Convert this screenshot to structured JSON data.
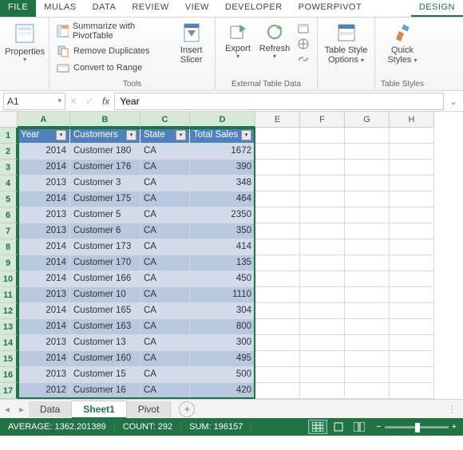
{
  "tabs": {
    "file": "FILE",
    "items": [
      "MULAS",
      "DATA",
      "REVIEW",
      "VIEW",
      "DEVELOPER",
      "POWERPIVOT"
    ],
    "active": "DESIGN"
  },
  "ribbon": {
    "properties": "Properties",
    "tools": {
      "pivot": "Summarize with PivotTable",
      "dedup": "Remove Duplicates",
      "range": "Convert to Range",
      "label": "Tools"
    },
    "slicer": {
      "top": "Insert",
      "bot": "Slicer"
    },
    "export": "Export",
    "refresh": "Refresh",
    "extlabel": "External Table Data",
    "styleopt": {
      "top": "Table Style",
      "bot": "Options"
    },
    "quick": {
      "top": "Quick",
      "bot": "Styles"
    },
    "styleslabel": "Table Styles"
  },
  "namebox": "A1",
  "formula": "Year",
  "colwidths": {
    "A": 66,
    "B": 88,
    "C": 62,
    "D": 82,
    "E": 56,
    "F": 56,
    "G": 56,
    "H": 56
  },
  "columns": [
    "A",
    "B",
    "C",
    "D",
    "E",
    "F",
    "G",
    "H"
  ],
  "headers": [
    "Year",
    "Customers",
    "State",
    "Total Sales"
  ],
  "rows": [
    {
      "n": 1,
      "y": "",
      "c": "",
      "s": "",
      "t": ""
    },
    {
      "n": 2,
      "y": "2014",
      "c": "Customer 180",
      "s": "CA",
      "t": "1672"
    },
    {
      "n": 3,
      "y": "2014",
      "c": "Customer 176",
      "s": "CA",
      "t": "390"
    },
    {
      "n": 4,
      "y": "2013",
      "c": "Customer 3",
      "s": "CA",
      "t": "348"
    },
    {
      "n": 5,
      "y": "2014",
      "c": "Customer 175",
      "s": "CA",
      "t": "464"
    },
    {
      "n": 6,
      "y": "2013",
      "c": "Customer 5",
      "s": "CA",
      "t": "2350"
    },
    {
      "n": 7,
      "y": "2013",
      "c": "Customer 6",
      "s": "CA",
      "t": "350"
    },
    {
      "n": 8,
      "y": "2014",
      "c": "Customer 173",
      "s": "CA",
      "t": "414"
    },
    {
      "n": 9,
      "y": "2014",
      "c": "Customer 170",
      "s": "CA",
      "t": "135"
    },
    {
      "n": 10,
      "y": "2014",
      "c": "Customer 166",
      "s": "CA",
      "t": "450"
    },
    {
      "n": 11,
      "y": "2013",
      "c": "Customer 10",
      "s": "CA",
      "t": "1110"
    },
    {
      "n": 12,
      "y": "2014",
      "c": "Customer 165",
      "s": "CA",
      "t": "304"
    },
    {
      "n": 13,
      "y": "2014",
      "c": "Customer 163",
      "s": "CA",
      "t": "800"
    },
    {
      "n": 14,
      "y": "2013",
      "c": "Customer 13",
      "s": "CA",
      "t": "300"
    },
    {
      "n": 15,
      "y": "2014",
      "c": "Customer 160",
      "s": "CA",
      "t": "495"
    },
    {
      "n": 16,
      "y": "2013",
      "c": "Customer 15",
      "s": "CA",
      "t": "500"
    },
    {
      "n": 17,
      "y": "2012",
      "c": "Customer 16",
      "s": "CA",
      "t": "420"
    }
  ],
  "sheets": {
    "items": [
      "Data",
      "Sheet1",
      "Pivot"
    ],
    "active": 1
  },
  "status": {
    "avg_label": "AVERAGE:",
    "avg": "1362.201389",
    "count_label": "COUNT:",
    "count": "292",
    "sum_label": "SUM:",
    "sum": "196157"
  }
}
